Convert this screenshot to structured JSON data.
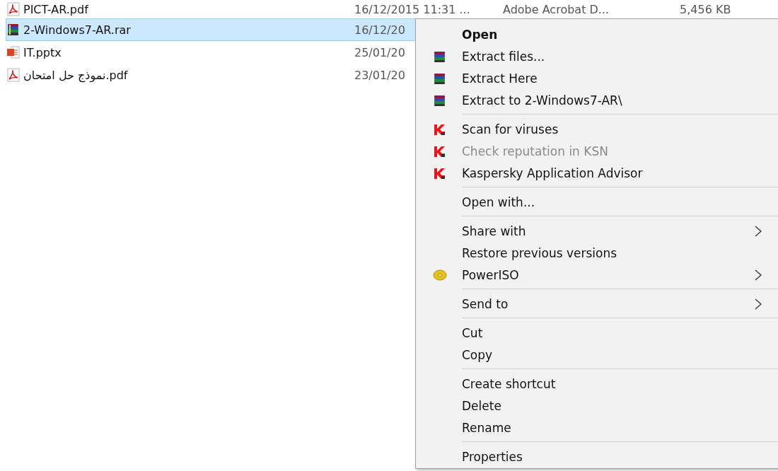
{
  "files": [
    {
      "name": "PICT-AR.pdf",
      "kind": "pdf",
      "date": "16/12/2015 11:31 ...",
      "type": "Adobe Acrobat D...",
      "size": "5,456 KB",
      "selected": false
    },
    {
      "name": "2-Windows7-AR.rar",
      "kind": "rar",
      "date": "16/12/20",
      "selected": true
    },
    {
      "name": "IT.pptx",
      "kind": "pptx",
      "date": "25/01/20",
      "selected": false
    },
    {
      "name": "نموذج حل امتحان.pdf",
      "kind": "pdf",
      "date": "23/01/20",
      "selected": false
    }
  ],
  "context_menu": [
    {
      "kind": "plain",
      "label": "Open",
      "bold": true
    },
    {
      "kind": "rar",
      "label": "Extract files..."
    },
    {
      "kind": "rar",
      "label": "Extract Here"
    },
    {
      "kind": "rar",
      "label": "Extract to 2-Windows7-AR\\"
    },
    {
      "kind": "separator"
    },
    {
      "kind": "kaspersky",
      "label": "Scan for viruses",
      "disabled": false
    },
    {
      "kind": "kaspersky",
      "label": "Check reputation in KSN",
      "disabled": true
    },
    {
      "kind": "kaspersky",
      "label": "Kaspersky Application Advisor",
      "disabled": false
    },
    {
      "kind": "separator"
    },
    {
      "kind": "plain",
      "label": "Open with..."
    },
    {
      "kind": "separator"
    },
    {
      "kind": "plain",
      "label": "Share with",
      "submenu": true
    },
    {
      "kind": "plain",
      "label": "Restore previous versions"
    },
    {
      "kind": "disc",
      "label": "PowerISO",
      "submenu": true
    },
    {
      "kind": "separator"
    },
    {
      "kind": "plain",
      "label": "Send to",
      "submenu": true
    },
    {
      "kind": "separator"
    },
    {
      "kind": "plain",
      "label": "Cut"
    },
    {
      "kind": "plain",
      "label": "Copy"
    },
    {
      "kind": "separator"
    },
    {
      "kind": "plain",
      "label": "Create shortcut"
    },
    {
      "kind": "plain",
      "label": "Delete"
    },
    {
      "kind": "plain",
      "label": "Rename"
    },
    {
      "kind": "separator"
    },
    {
      "kind": "plain",
      "label": "Properties"
    }
  ]
}
